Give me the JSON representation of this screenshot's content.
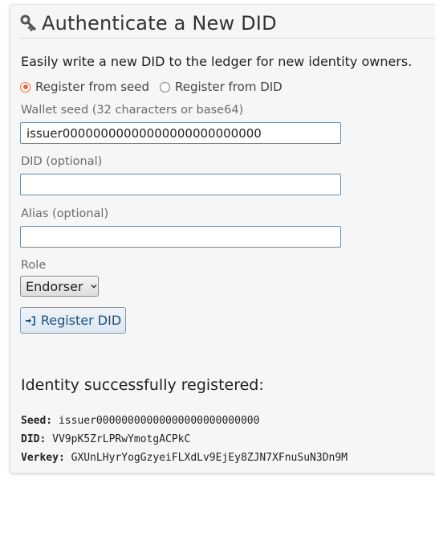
{
  "panel": {
    "title": "Authenticate a New DID",
    "title_icon": "key-icon",
    "intro": "Easily write a new DID to the ledger for new identity owners."
  },
  "mode": {
    "options": [
      {
        "label": "Register from seed",
        "checked": true
      },
      {
        "label": "Register from DID",
        "checked": false
      }
    ]
  },
  "form": {
    "seed_label": "Wallet seed (32 characters or base64)",
    "seed_value": "issuer00000000000000000000000000",
    "did_label": "DID (optional)",
    "did_value": "",
    "alias_label": "Alias (optional)",
    "alias_value": "",
    "role_label": "Role",
    "role_value": "Endorser",
    "submit_label": "Register DID",
    "submit_icon": "sign-in-icon"
  },
  "result": {
    "title": "Identity successfully registered:",
    "seed_key": "Seed:",
    "seed_val": "issuer00000000000000000000000000",
    "did_key": "DID:",
    "did_val": "VV9pK5ZrLPRwYmotgACPkC",
    "verkey_key": "Verkey:",
    "verkey_val": "GXUnLHyrYogGzyeiFLXdLv9EjEy8ZJN7XFnuSuN3Dn9M"
  },
  "colors": {
    "accent_radio": "#e8683e",
    "button_text": "#1f4f7a",
    "input_border": "#6e8aa0"
  }
}
